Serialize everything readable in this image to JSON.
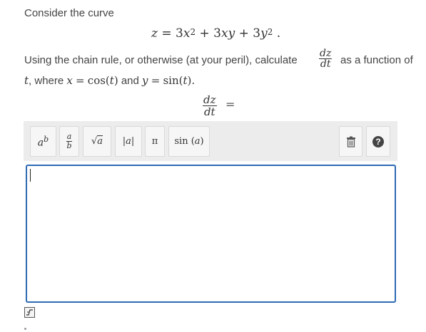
{
  "question": {
    "intro": "Consider the curve",
    "equation": {
      "lhs": "z",
      "eq": "=",
      "t1_coef": "3",
      "t1_var": "x",
      "t1_exp": "2",
      "plus1": "+",
      "t2_coef": "3",
      "t2_var": "xy",
      "plus2": "+",
      "t3_coef": "3",
      "t3_var": "y",
      "t3_exp": "2",
      "end": "."
    },
    "instruction_start": "Using the chain rule, or otherwise (at your peril), calculate",
    "instruction_end": "as a function of",
    "deriv_num": "dz",
    "deriv_den": "dt",
    "line2": {
      "t": "t",
      "where": ", where",
      "x": "x",
      "eq1": "=",
      "cos": "cos(",
      "t_a": "t",
      "close1": ")",
      "and": "and",
      "y": "y",
      "eq2": "=",
      "sin": "sin(",
      "t_b": "t",
      "close2": ").",
      "close2_dummy": ""
    },
    "answer_label_num": "dz",
    "answer_label_den": "dt",
    "answer_equals": "="
  },
  "toolbar": {
    "power_base": "a",
    "power_exp": "b",
    "frac_num": "a",
    "frac_den": "b",
    "sqrt_sym": "√",
    "sqrt_arg": "a",
    "abs_open": "|",
    "abs_arg": "a",
    "abs_close": "|",
    "pi": "π",
    "sin_label": "sin",
    "sin_arg_open": "(",
    "sin_arg": "a",
    "sin_arg_close": ")",
    "help": "?"
  },
  "editor": {
    "value": ""
  },
  "icons": {
    "power": "power-icon",
    "fraction": "fraction-icon",
    "sqrt": "sqrt-icon",
    "abs": "abs-icon",
    "pi": "pi-icon",
    "sin": "sin-icon",
    "trash": "trash-icon",
    "help": "help-icon",
    "formula": "formula-icon"
  },
  "colors": {
    "editor_border": "#2e6ab3",
    "toolbar_bg": "#ececec",
    "help_bg": "#444444"
  }
}
